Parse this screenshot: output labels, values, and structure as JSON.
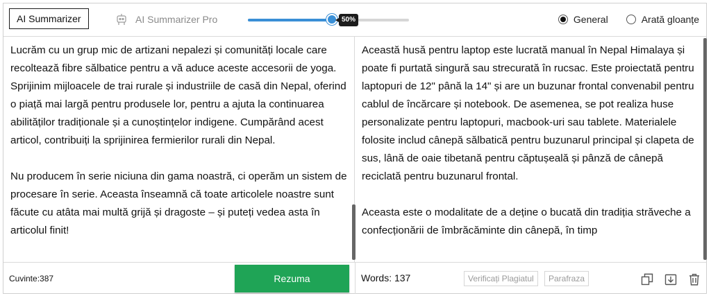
{
  "toolbar": {
    "summarizer_label": "AI Summarizer",
    "pro_label": "AI Summarizer Pro",
    "pro_icon": "robot-icon",
    "length_slider_percent": 50,
    "length_slider_label": "50%",
    "modes": [
      {
        "label": "General",
        "selected": true
      },
      {
        "label": "Arată gloanțe",
        "selected": false
      }
    ]
  },
  "input_text": {
    "paragraphs": [
      "Lucrăm cu un grup mic de artizani nepalezi și comunități locale care recoltează fibre sălbatice pentru a vă aduce aceste accesorii de yoga. Sprijinim mijloacele de trai rurale și industriile de casă din Nepal, oferind o piață mai largă pentru produsele lor, pentru a ajuta la continuarea abilităților tradiționale și a cunoștințelor indigene. Cumpărând acest articol, contribuiți la sprijinirea fermierilor rurali din Nepal.",
      "Nu producem în serie niciuna din gama noastră, ci operăm un sistem de procesare în serie. Aceasta înseamnă că toate articolele noastre sunt făcute cu atâta mai multă grijă și dragoste – și puteți vedea asta în articolul finit!"
    ]
  },
  "output_text": {
    "paragraphs": [
      "Această husă pentru laptop este lucrată manual în Nepal Himalaya și poate fi purtată singură sau strecurată în rucsac. Este proiectată pentru laptopuri de 12\" până la 14\" și are un buzunar frontal convenabil pentru cablul de încărcare și notebook. De asemenea, se pot realiza huse personalizate pentru laptopuri, macbook-uri sau tablete. Materialele folosite includ cânepă sălbatică pentru buzunarul principal și clapeta de sus, lână de oaie tibetană pentru căptușeală și pânză de cânepă reciclată pentru buzunarul frontal.",
      "Aceasta este o modalitate de a deține o bucată din tradiția străveche a confecționării de îmbrăcăminte din cânepă, în timp"
    ]
  },
  "bottom": {
    "left_count": "Cuvinte:387",
    "summarize_label": "Rezuma",
    "right_count": "Words: 137",
    "plagiarism_label": "Verificați Plagiatul",
    "paraphrase_label": "Parafraza",
    "icons": [
      "copy-icon",
      "download-icon",
      "trash-icon"
    ]
  },
  "colors": {
    "accent_blue": "#3a8fd6",
    "summarize_green": "#1fa456"
  }
}
